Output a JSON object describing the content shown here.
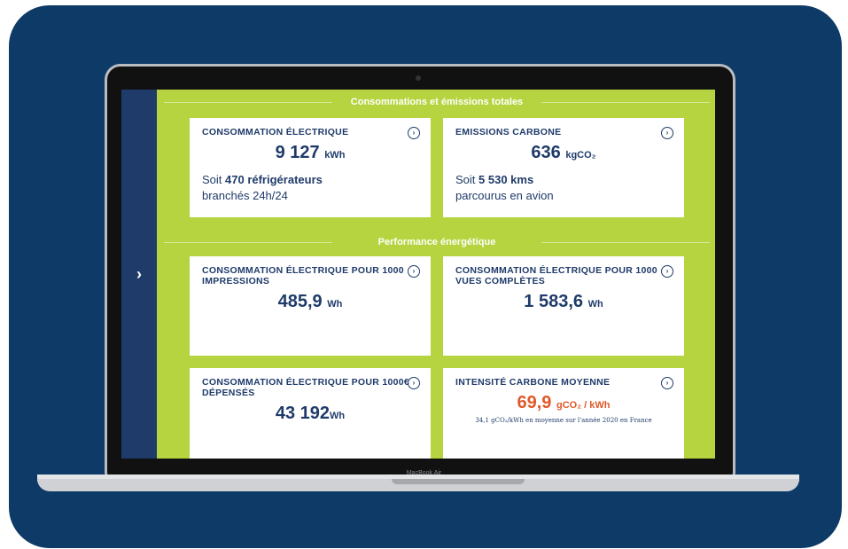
{
  "sections": {
    "totals_title": "Consommations et émissions totales",
    "performance_title": "Performance énergétique"
  },
  "cards": {
    "electric": {
      "title": "CONSOMMATION ÉLECTRIQUE",
      "value": "9 127",
      "unit": "kWh",
      "desc_prefix": "Soit ",
      "desc_bold": "470 réfrigérateurs",
      "desc_line2": "branchés 24h/24"
    },
    "carbon": {
      "title": "EMISSIONS CARBONE",
      "value": "636",
      "unit": "kgCO₂",
      "desc_prefix": "Soit ",
      "desc_bold": "5 530 kms",
      "desc_line2": "parcourus en avion"
    },
    "per_1000_impressions": {
      "title": "CONSOMMATION ÉLECTRIQUE POUR 1000 IMPRESSIONS",
      "value": "485,9",
      "unit": "Wh"
    },
    "per_1000_views": {
      "title": "CONSOMMATION ÉLECTRIQUE POUR 1000 VUES COMPLÈTES",
      "value": "1 583,6",
      "unit": "Wh"
    },
    "per_1000_spent": {
      "title": "CONSOMMATION ÉLECTRIQUE POUR 1000€ DÉPENSÉS",
      "value": "43 192",
      "unit": "Wh"
    },
    "carbon_intensity": {
      "title": "INTENSITÉ CARBONE MOYENNE",
      "value": "69,9",
      "unit": "gCO₂ / kWh",
      "note": "34,1 gCO₂/kWh en moyenne sur l'année 2020 en France"
    }
  },
  "device_label": "MacBook Air",
  "icons": {
    "sidebar_toggle": "chevron-right-icon",
    "card_arrow": "circle-chevron-right-icon"
  },
  "colors": {
    "background": "#0d3a66",
    "screen": "#b5d43f",
    "accent": "#e0592a",
    "text": "#1f3b6a"
  }
}
